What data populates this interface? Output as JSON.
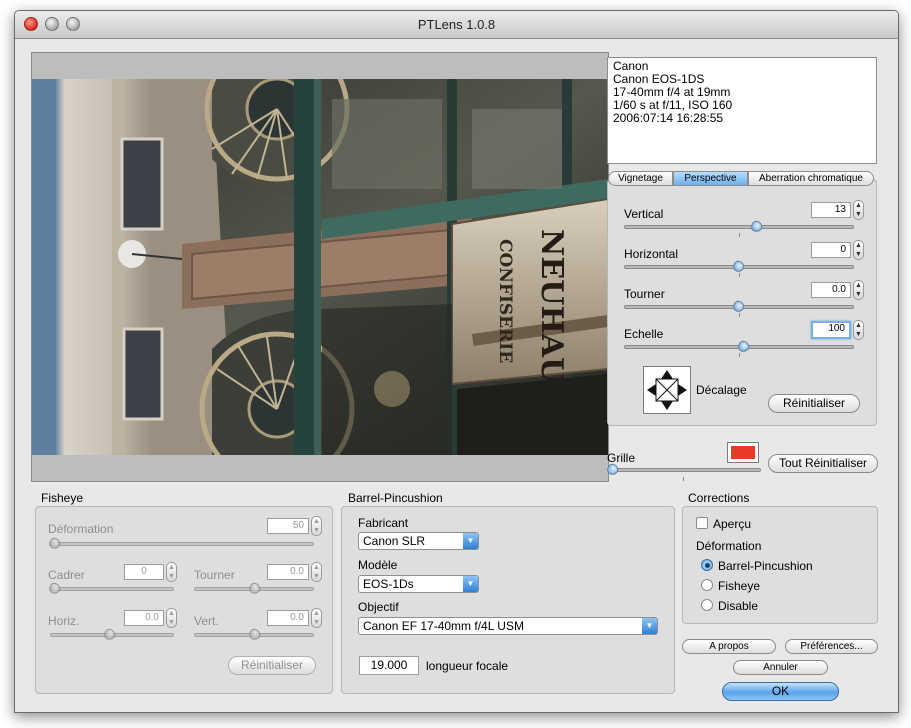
{
  "window": {
    "title": "PTLens 1.0.8"
  },
  "photo": {
    "sign_text_1": "CONFISERIE",
    "sign_text_2": "NEUHAUS"
  },
  "exif": {
    "lines": [
      "Canon",
      "Canon EOS-1DS",
      "17-40mm f/4 at 19mm",
      "1/60 s at f/11, ISO 160",
      "2006:07:14 16:28:55"
    ]
  },
  "tabs": [
    {
      "label": "Vignetage",
      "active": false
    },
    {
      "label": "Perspective",
      "active": true
    },
    {
      "label": "Aberration chromatique",
      "active": false
    }
  ],
  "perspective": {
    "vertical_label": "Vertical",
    "vertical_value": "13",
    "vertical_level": 0.58,
    "horizontal_label": "Horizontal",
    "horizontal_value": "0",
    "horizontal_level": 0.5,
    "tourner_label": "Tourner",
    "tourner_value": "0.0",
    "tourner_level": 0.5,
    "echelle_label": "Echelle",
    "echelle_value": "100",
    "echelle_level": 0.52,
    "decalage_label": "Décalage",
    "reset_label": "Réinitialiser"
  },
  "grid": {
    "label": "Grille",
    "swatch_color": "#e83a26",
    "reset_all_label": "Tout Réinitialiser"
  },
  "fisheye": {
    "title": "Fisheye",
    "deformation_label": "Déformation",
    "deformation_value": "50",
    "cadrer_label": "Cadrer",
    "cadrer_value": "0",
    "tourner_label": "Tourner",
    "tourner_value": "0.0",
    "horiz_label": "Horiz.",
    "horiz_value": "0.0",
    "vert_label": "Vert.",
    "vert_value": "0.0",
    "reset_label": "Réinitialiser"
  },
  "barrel": {
    "title": "Barrel-Pincushion",
    "fabricant_label": "Fabricant",
    "fabricant_value": "Canon SLR",
    "modele_label": "Modèle",
    "modele_value": "EOS-1Ds",
    "objectif_label": "Objectif",
    "objectif_value": "Canon EF 17-40mm f/4L USM",
    "focal_value": "19.000",
    "focal_label": "longueur focale"
  },
  "corrections": {
    "title": "Corrections",
    "apercu_label": "Aperçu",
    "deformation_label": "Déformation",
    "options": [
      {
        "label": "Barrel-Pincushion",
        "checked": true
      },
      {
        "label": "Fisheye",
        "checked": false
      },
      {
        "label": "Disable",
        "checked": false
      }
    ]
  },
  "buttons": {
    "apropos": "A propos",
    "preferences": "Préférences...",
    "annuler": "Annuler",
    "ok": "OK"
  }
}
